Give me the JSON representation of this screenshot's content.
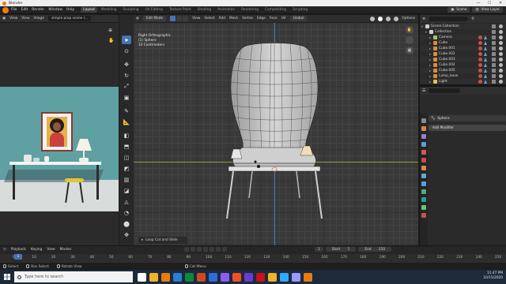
{
  "window": {
    "title": "Blender",
    "controls": [
      "—",
      "☐",
      "✕"
    ]
  },
  "topbar": {
    "menu": [
      "File",
      "Edit",
      "Render",
      "Window",
      "Help"
    ],
    "workspaces": [
      "Layout",
      "Modeling",
      "Sculpting",
      "UV Editing",
      "Texture Paint",
      "Shading",
      "Animation",
      "Rendering",
      "Compositing",
      "Scripting"
    ],
    "active_workspace": "Layout",
    "scene_label": "Scene",
    "view_layer_label": "View Layer"
  },
  "image_editor": {
    "view": "View",
    "menus": [
      "View",
      "Image"
    ],
    "image_name": "simple prop scene r..."
  },
  "viewport": {
    "mode": "Edit Mode",
    "menus": [
      "View",
      "Select",
      "Add",
      "Mesh",
      "Vertex",
      "Edge",
      "Face",
      "UV"
    ],
    "transform": "Global",
    "options_label": "Options",
    "info": [
      "Right Orthographic",
      "(1) Sphere",
      "10 Centimeters"
    ],
    "operator_panel": "Loop Cut and Slide",
    "gizmo": [
      "✋",
      "🎥",
      "▦"
    ]
  },
  "outliner": {
    "rows": [
      {
        "name": "Scene Collection",
        "indent": 0,
        "icon": "#cfcfcf"
      },
      {
        "name": "Collection",
        "indent": 1,
        "icon": "#cfcfcf"
      },
      {
        "name": "Camera",
        "indent": 2,
        "icon": "#a6c46a"
      },
      {
        "name": "Cube",
        "indent": 2,
        "icon": "#e08a3c"
      },
      {
        "name": "Cube.001",
        "indent": 2,
        "icon": "#e08a3c"
      },
      {
        "name": "Cube.002",
        "indent": 2,
        "icon": "#e08a3c"
      },
      {
        "name": "Cube.003",
        "indent": 2,
        "icon": "#e08a3c"
      },
      {
        "name": "Cube.004",
        "indent": 2,
        "icon": "#e08a3c"
      },
      {
        "name": "Cube.005",
        "indent": 2,
        "icon": "#e08a3c"
      },
      {
        "name": "Lamp_base",
        "indent": 2,
        "icon": "#e08a3c"
      },
      {
        "name": "Light",
        "indent": 2,
        "icon": "#e0c25a"
      }
    ]
  },
  "properties": {
    "object_name": "Sphere",
    "add_modifier_label": "Add Modifier"
  },
  "timeline": {
    "menus": [
      "Playback",
      "Keying",
      "View",
      "Marker"
    ],
    "current_frame": "1",
    "start_label": "Start",
    "start_value": "1",
    "end_label": "End",
    "end_value": "250",
    "ticks": [
      "0",
      "10",
      "20",
      "30",
      "40",
      "50",
      "60",
      "70",
      "80",
      "90",
      "100",
      "110",
      "120",
      "130",
      "140",
      "150",
      "160",
      "170",
      "180",
      "190",
      "200",
      "210",
      "220",
      "230",
      "240",
      "250"
    ]
  },
  "statusbar": {
    "items": [
      "Select",
      "Box Select",
      "Rotate View",
      "Call Menu"
    ]
  },
  "taskbar": {
    "search_placeholder": "Type here to search",
    "time": "11:47 PM",
    "date": "10/15/2020",
    "app_colors": [
      "#ffffff",
      "#f0b429",
      "#e87d0d",
      "#2b7fd6",
      "#0a8a3c",
      "#d24726",
      "#2e6bdc",
      "#8b5cf6",
      "#f25022",
      "#6c3bd1",
      "#c5121b",
      "#f0b429",
      "#31a8ff",
      "#9999ff",
      "#e87d0d"
    ]
  }
}
